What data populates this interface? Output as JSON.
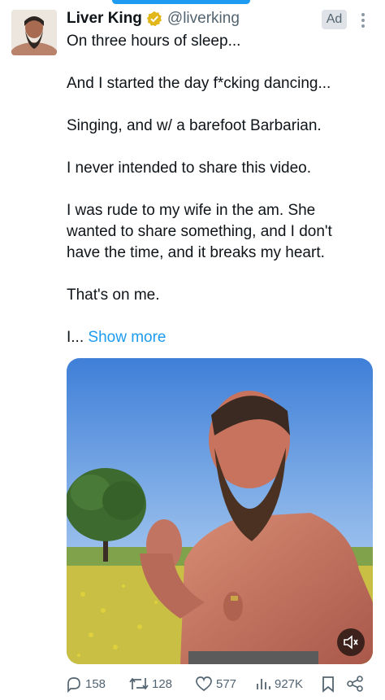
{
  "tweet": {
    "display_name": "Liver King",
    "handle": "@liverking",
    "ad_label": "Ad",
    "paragraphs": [
      "On three hours of sleep...",
      "And I started the day f*cking dancing...",
      "Singing, and w/ a barefoot Barbarian.",
      "I never intended to share this video.",
      "I was rude to my wife in the am. She wanted to share something, and I don't have the time, and it breaks my heart.",
      "That's on me."
    ],
    "truncated_text": "I...",
    "show_more_label": "Show more"
  },
  "actions": {
    "replies": "158",
    "retweets": "128",
    "likes": "577",
    "views": "927K"
  },
  "icons": {
    "verified": "verified-badge-icon",
    "more": "more-options-icon",
    "mute": "muted-speaker-icon",
    "reply": "reply-icon",
    "retweet": "retweet-icon",
    "like": "heart-icon",
    "views": "views-chart-icon",
    "bookmark": "bookmark-icon",
    "share": "share-icon"
  },
  "colors": {
    "accent": "#1d9bf0",
    "verified_gold": "#e2b719",
    "secondary_text": "#536471"
  }
}
